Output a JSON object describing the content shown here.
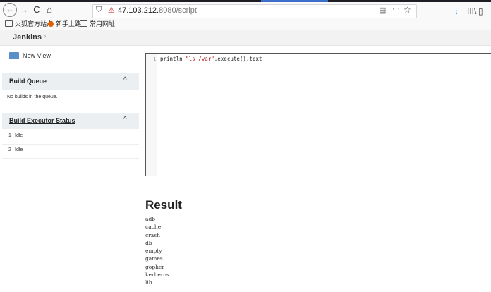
{
  "browser": {
    "nav_icons": {
      "back": "←",
      "forward": "→",
      "reload": "C",
      "home": "⌂"
    },
    "url_bold": "47.103.212.",
    "url_rest": "8080/script",
    "url_dots": "···",
    "star_icon": "☆",
    "download_icon": "↓",
    "library_icon": "III\\",
    "sidebar_icon": "▯"
  },
  "bookmarks": [
    {
      "label": "火狐官方站点",
      "icon": "folder"
    },
    {
      "label": "新手上路",
      "icon": "firefox"
    },
    {
      "label": "常用网址",
      "icon": "folder"
    }
  ],
  "header": {
    "breadcrumb": "Jenkins",
    "arrow": "›"
  },
  "sidebar": {
    "new_view": "New View",
    "build_queue": {
      "title": "Build Queue",
      "empty_text": "No builds in the queue.",
      "chevron": "^"
    },
    "executor": {
      "title": "Build Executor Status",
      "chevron": "^",
      "rows": [
        {
          "num": "1",
          "status": "Idle"
        },
        {
          "num": "2",
          "status": "Idle"
        }
      ]
    }
  },
  "editor": {
    "line_number": "1",
    "code_before": "println ",
    "code_string": "\"ls /var\"",
    "code_after": ".execute().text"
  },
  "result": {
    "title": "Result",
    "lines": [
      "adb",
      "cache",
      "crash",
      "db",
      "empty",
      "games",
      "gopher",
      "kerberos",
      "lib"
    ]
  },
  "colors": {
    "accent": "#3d6ec9",
    "editor_border": "#555555",
    "panel_header": "#eceff1"
  }
}
